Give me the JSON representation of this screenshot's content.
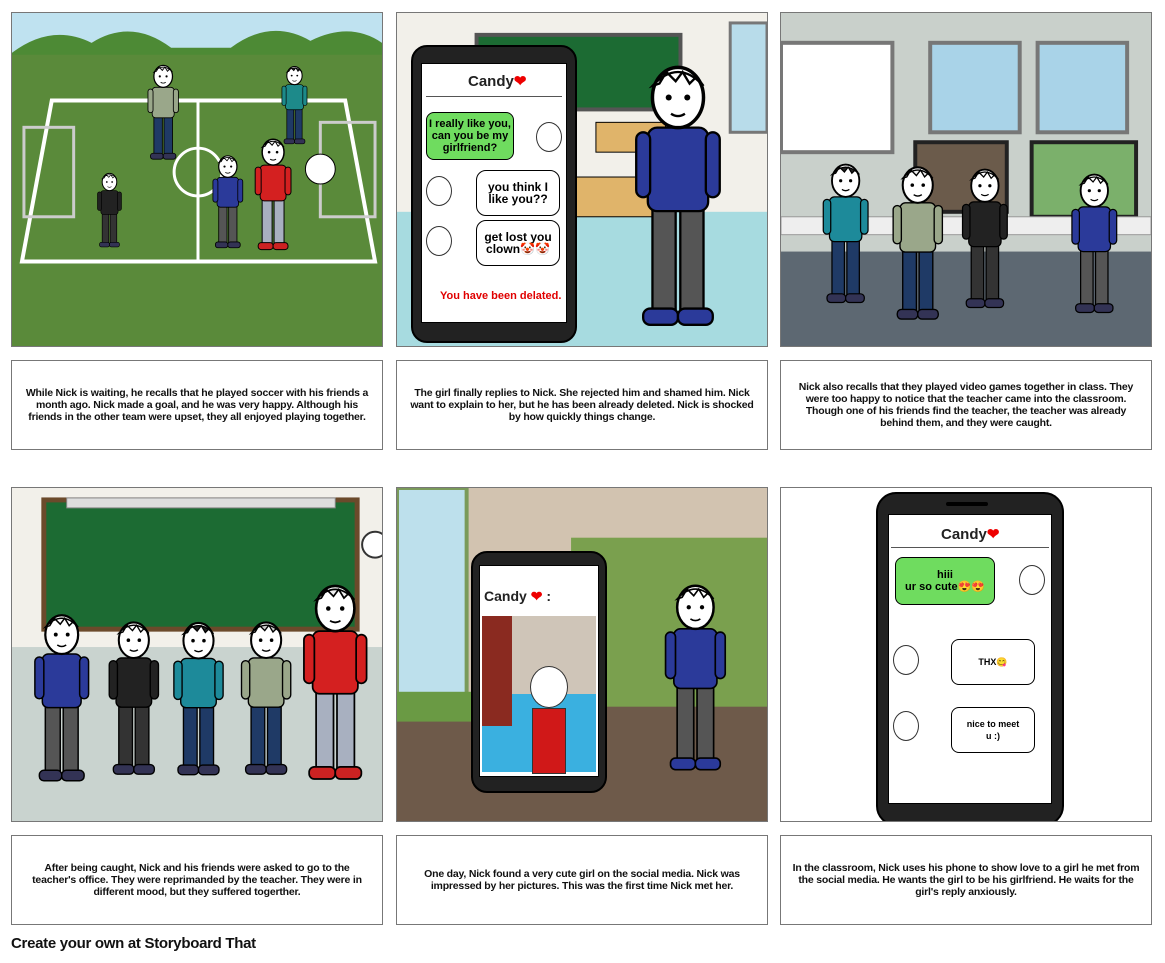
{
  "panels": [
    {
      "caption": "While Nick is waiting, he recalls that he played soccer with his friends a month ago. Nick made a goal, and he was very happy. Although his friends in the other team were upset, they all enjoyed playing together."
    },
    {
      "caption": "The girl finally replies to Nick. She rejected him and shamed him. Nick want to explain to her, but he has been already deleted. Nick is shocked by how quickly things change.",
      "phone": {
        "title": "Candy",
        "heart": "❤",
        "messages": [
          "I really like you, can you be my girlfriend?",
          "you think I like you??",
          "get lost you clown🤡🤡"
        ],
        "status": "You have been delated."
      }
    },
    {
      "caption": "Nick also recalls that they played video games together in class. They were too happy to notice that the teacher came into the classroom. Though one of his friends find the teacher, the teacher was already behind them, and they were caught."
    },
    {
      "caption": "After being caught, Nick and his friends were asked to go to the teacher's office. They were reprimanded by the teacher. They were in different mood, but they suffered togerther."
    },
    {
      "caption": "One day, Nick found a very cute girl on the social media. Nick was impressed by her pictures. This was the first time Nick met her.",
      "phone": {
        "title": "Candy",
        "heart": "❤",
        "suffix": ":"
      }
    },
    {
      "caption": "In the classroom, Nick uses his phone to show love to a girl he met from the social media. He wants the girl to be his girlfriend. He waits for the girl's reply anxiously.",
      "phone": {
        "title": "Candy",
        "heart": "❤",
        "messages": [
          "hiii\nur so cute😍😍",
          "THX😋",
          "nice to meet u :)"
        ]
      }
    }
  ],
  "footer": "Create your own at Storyboard That",
  "colors": {
    "grass": "#5a8a3a",
    "bubble_green": "#6fdc5f",
    "status_red": "#e00000",
    "border": "#777777"
  }
}
